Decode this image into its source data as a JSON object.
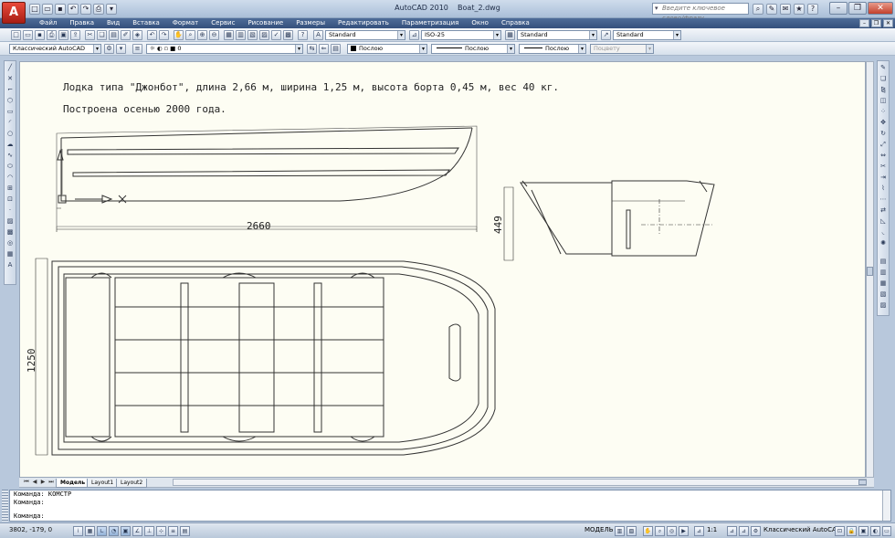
{
  "window": {
    "app_name": "AutoCAD 2010",
    "file_name": "Boat_2.dwg",
    "search_placeholder": "Введите ключевое слово/фразу"
  },
  "menu": [
    "Файл",
    "Правка",
    "Вид",
    "Вставка",
    "Формат",
    "Сервис",
    "Рисование",
    "Размеры",
    "Редактировать",
    "Параметризация",
    "Окно",
    "Справка"
  ],
  "toolbar1": {
    "text_style": "Standard",
    "dim_style": "ISO-25",
    "table_style": "Standard",
    "mleader_style": "Standard"
  },
  "toolbar2": {
    "workspace": "Классический AutoCAD",
    "layer": "0",
    "color": "Послою",
    "linetype": "Послою",
    "lineweight": "Послою",
    "plotstyle": "Поцвету"
  },
  "drawing": {
    "note_line1": "Лодка типа \"Джонбот\", длина 2,66 м, ширина 1,25 м, высота борта 0,45 м, вес 40 кг.",
    "note_line2": "Построена осенью 2000 года.",
    "dim_length": "2660",
    "dim_width": "1250",
    "dim_height": "449"
  },
  "layout_tabs": [
    "Модель",
    "Layout1",
    "Layout2"
  ],
  "active_tab": "Модель",
  "command_line": {
    "history": [
      "Команда: КОМСТР",
      "Команда:"
    ],
    "prompt": "Команда:"
  },
  "status": {
    "coordinates": "3802, -179, 0",
    "space": "МОДЕЛЬ",
    "scale": "1:1",
    "workspace": "Классический AutoCAD"
  },
  "colors": {
    "menubar": "#3f5d8a",
    "canvas": "#fdfdf3",
    "drawing_lines": "#333333"
  }
}
